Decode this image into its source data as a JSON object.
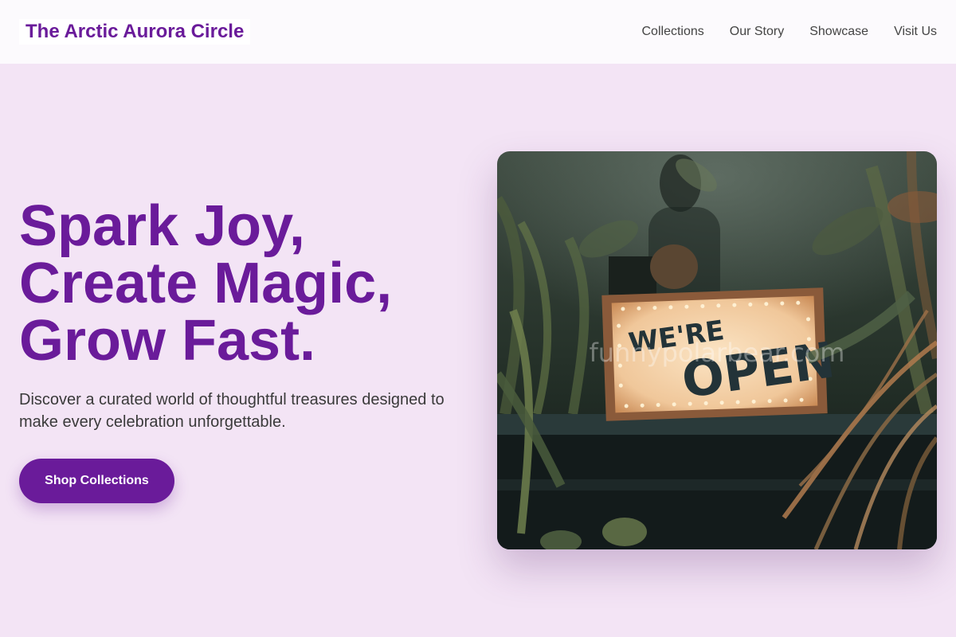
{
  "header": {
    "brand": "The Arctic Aurora Circle",
    "nav": [
      {
        "label": "Collections"
      },
      {
        "label": "Our Story"
      },
      {
        "label": "Showcase"
      },
      {
        "label": "Visit Us"
      }
    ]
  },
  "hero": {
    "headline_lines": [
      "Spark Joy,",
      "Create Magic,",
      "Grow Fast."
    ],
    "subtitle": "Discover a curated world of thoughtful treasures designed to make every celebration unforgettable.",
    "cta_label": "Shop Collections",
    "image": {
      "sign_line1": "WE'RE",
      "sign_line2": "OPEN",
      "watermark": "funnypolarbear.com"
    }
  },
  "colors": {
    "accent": "#6a1b9a",
    "background": "#f3e4f5",
    "header_bg": "#fcfafd"
  }
}
